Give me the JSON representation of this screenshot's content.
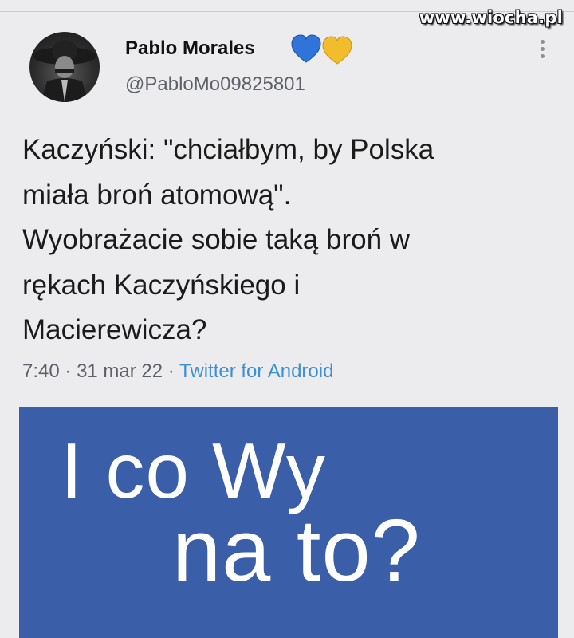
{
  "watermark": "www.wiocha.pl",
  "author": {
    "name": "Pablo Morales",
    "handle": "@PabloMo09825801",
    "hearts": [
      "blue-heart",
      "yellow-heart"
    ]
  },
  "tweet": {
    "lines": [
      "Kaczyński: \"chciałbym, by Polska",
      "miała broń atomową\".",
      "Wyobrażacie sobie taką broń w",
      "rękach Kaczyńskiego i",
      "Macierewicza?"
    ],
    "time": "7:40",
    "date": "31 mar 22",
    "separator": "·",
    "source": "Twitter for Android"
  },
  "banner": {
    "line1": "I co Wy",
    "line2": "na to?",
    "background": "#3a5ea8"
  },
  "colors": {
    "page_bg": "#ececee",
    "link": "#3b8fd4",
    "muted": "#5e6268"
  }
}
